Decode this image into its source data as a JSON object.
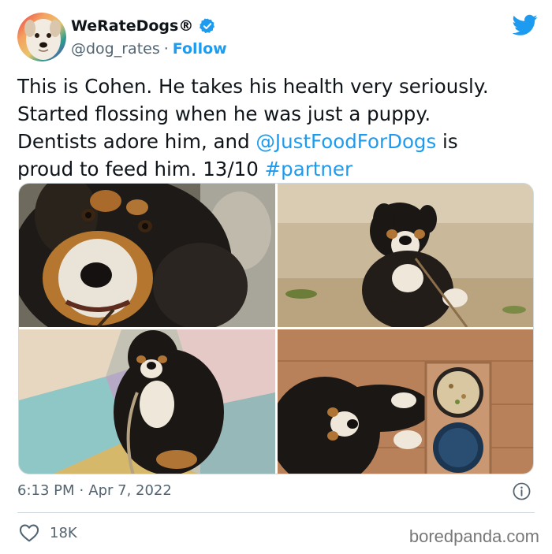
{
  "author": {
    "display_name": "WeRateDogs®",
    "handle": "@dog_rates",
    "separator": "·",
    "follow_label": "Follow",
    "verified_icon": "verified-badge-icon",
    "avatar_icon": "dog-avatar"
  },
  "tweet": {
    "text_line1": "This is Cohen. He takes his health very seriously.",
    "text_line2": "Started flossing when he was just a puppy.",
    "text_line3_pre": "Dentists adore him, and ",
    "mention": "@JustFoodForDogs",
    "text_line3_post": " is",
    "text_line4_pre": "proud to feed him. 13/10 ",
    "hashtag": "#partner"
  },
  "media": {
    "photos": [
      {
        "name": "puppy-closeup-photo"
      },
      {
        "name": "puppy-on-grass-photo"
      },
      {
        "name": "dog-sitting-photo"
      },
      {
        "name": "dog-with-bowls-photo"
      }
    ]
  },
  "meta": {
    "time": "6:13 PM",
    "dot": "·",
    "date": "Apr 7, 2022"
  },
  "engagement": {
    "likes": "18K"
  },
  "watermark": "boredpanda.com",
  "colors": {
    "accent": "#1d9bf0",
    "text": "#0f1419",
    "muted": "#536471",
    "border": "#cfd9de"
  }
}
